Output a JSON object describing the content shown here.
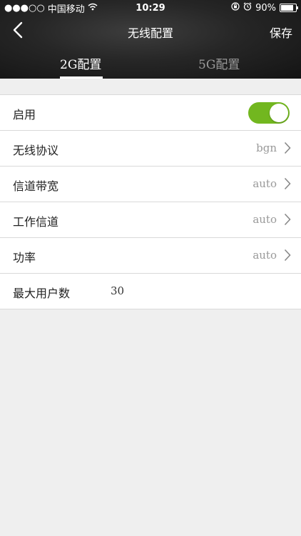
{
  "status_bar": {
    "signal": "●●●○○",
    "carrier": "中国移动",
    "wifi_icon": "wifi-icon",
    "time": "10:29",
    "battery": "90%",
    "battery_level": 0.9
  },
  "nav": {
    "title": "无线配置",
    "save_label": "保存",
    "back_icon": "chevron-left-icon"
  },
  "tabs": [
    {
      "label": "2G配置",
      "active": true
    },
    {
      "label": "5G配置",
      "active": false
    }
  ],
  "colors": {
    "toggle_on": "#72b71f",
    "header_bg": "#262626",
    "page_bg": "#efefef"
  },
  "settings": {
    "enable": {
      "label": "启用",
      "on": true
    },
    "protocol": {
      "label": "无线协议",
      "value": "bgn"
    },
    "bandwidth": {
      "label": "信道带宽",
      "value": "auto"
    },
    "channel": {
      "label": "工作信道",
      "value": "auto"
    },
    "power": {
      "label": "功率",
      "value": "auto"
    },
    "max_users": {
      "label": "最大用户数",
      "value": "30"
    }
  }
}
